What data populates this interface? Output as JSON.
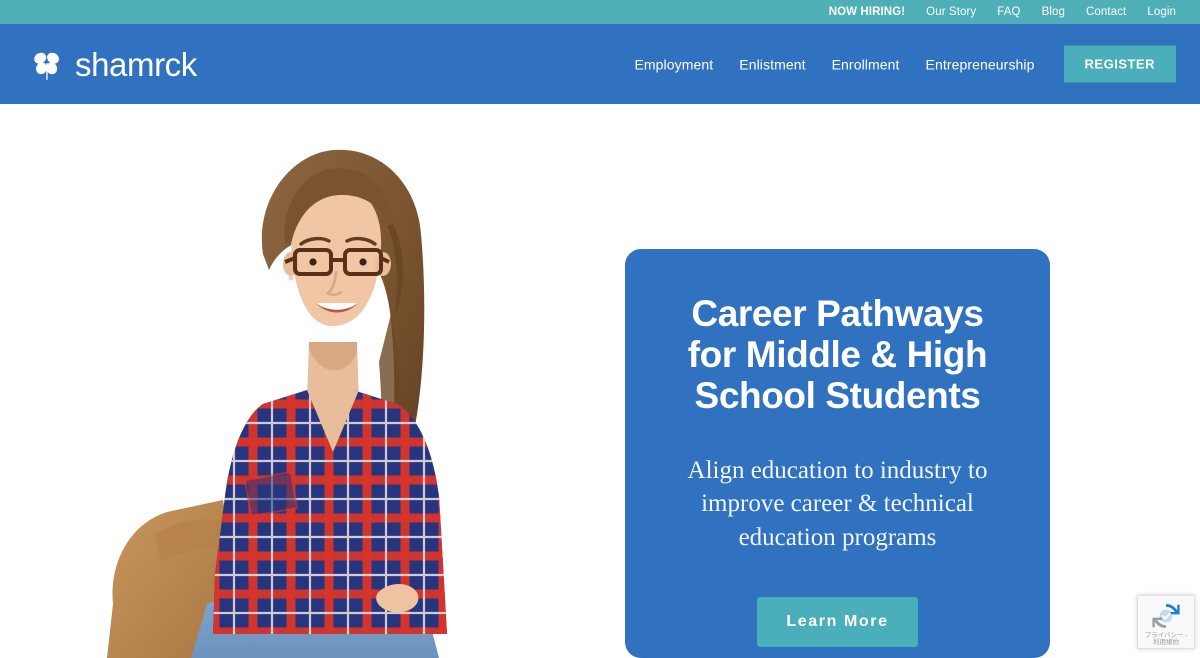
{
  "topbar": {
    "links": [
      {
        "label": "NOW HIRING!",
        "highlight": true
      },
      {
        "label": "Our Story",
        "highlight": false
      },
      {
        "label": "FAQ",
        "highlight": false
      },
      {
        "label": "Blog",
        "highlight": false
      },
      {
        "label": "Contact",
        "highlight": false
      },
      {
        "label": "Login",
        "highlight": false
      }
    ],
    "background_color": "#4FAFB6"
  },
  "header": {
    "brand_name": "shamrck",
    "brand_icon": "shamrock-clover-icon",
    "background_color": "#3071C0",
    "nav": [
      {
        "label": "Employment"
      },
      {
        "label": "Enlistment"
      },
      {
        "label": "Enrollment"
      },
      {
        "label": "Entrepreneurship"
      }
    ],
    "register_label": "REGISTER",
    "register_color": "#4AAFBA"
  },
  "hero": {
    "photo_alt": "smiling female student with glasses in red and blue plaid shirt sitting with tan backpack",
    "card": {
      "title_line_1": "Career Pathways",
      "title_line_2": "for Middle & High",
      "title_line_3": "School Students",
      "subtitle_line_1": "Align education to industry to",
      "subtitle_line_2": "improve career & technical",
      "subtitle_line_3": "education programs",
      "cta_label": "Learn More",
      "background_color": "#3071C0",
      "cta_color": "#4AAFBA"
    }
  },
  "recaptcha": {
    "logo_icon": "recaptcha-logo-icon",
    "text_line_1": "プライバシー  -",
    "text_line_2": "利用規約"
  }
}
